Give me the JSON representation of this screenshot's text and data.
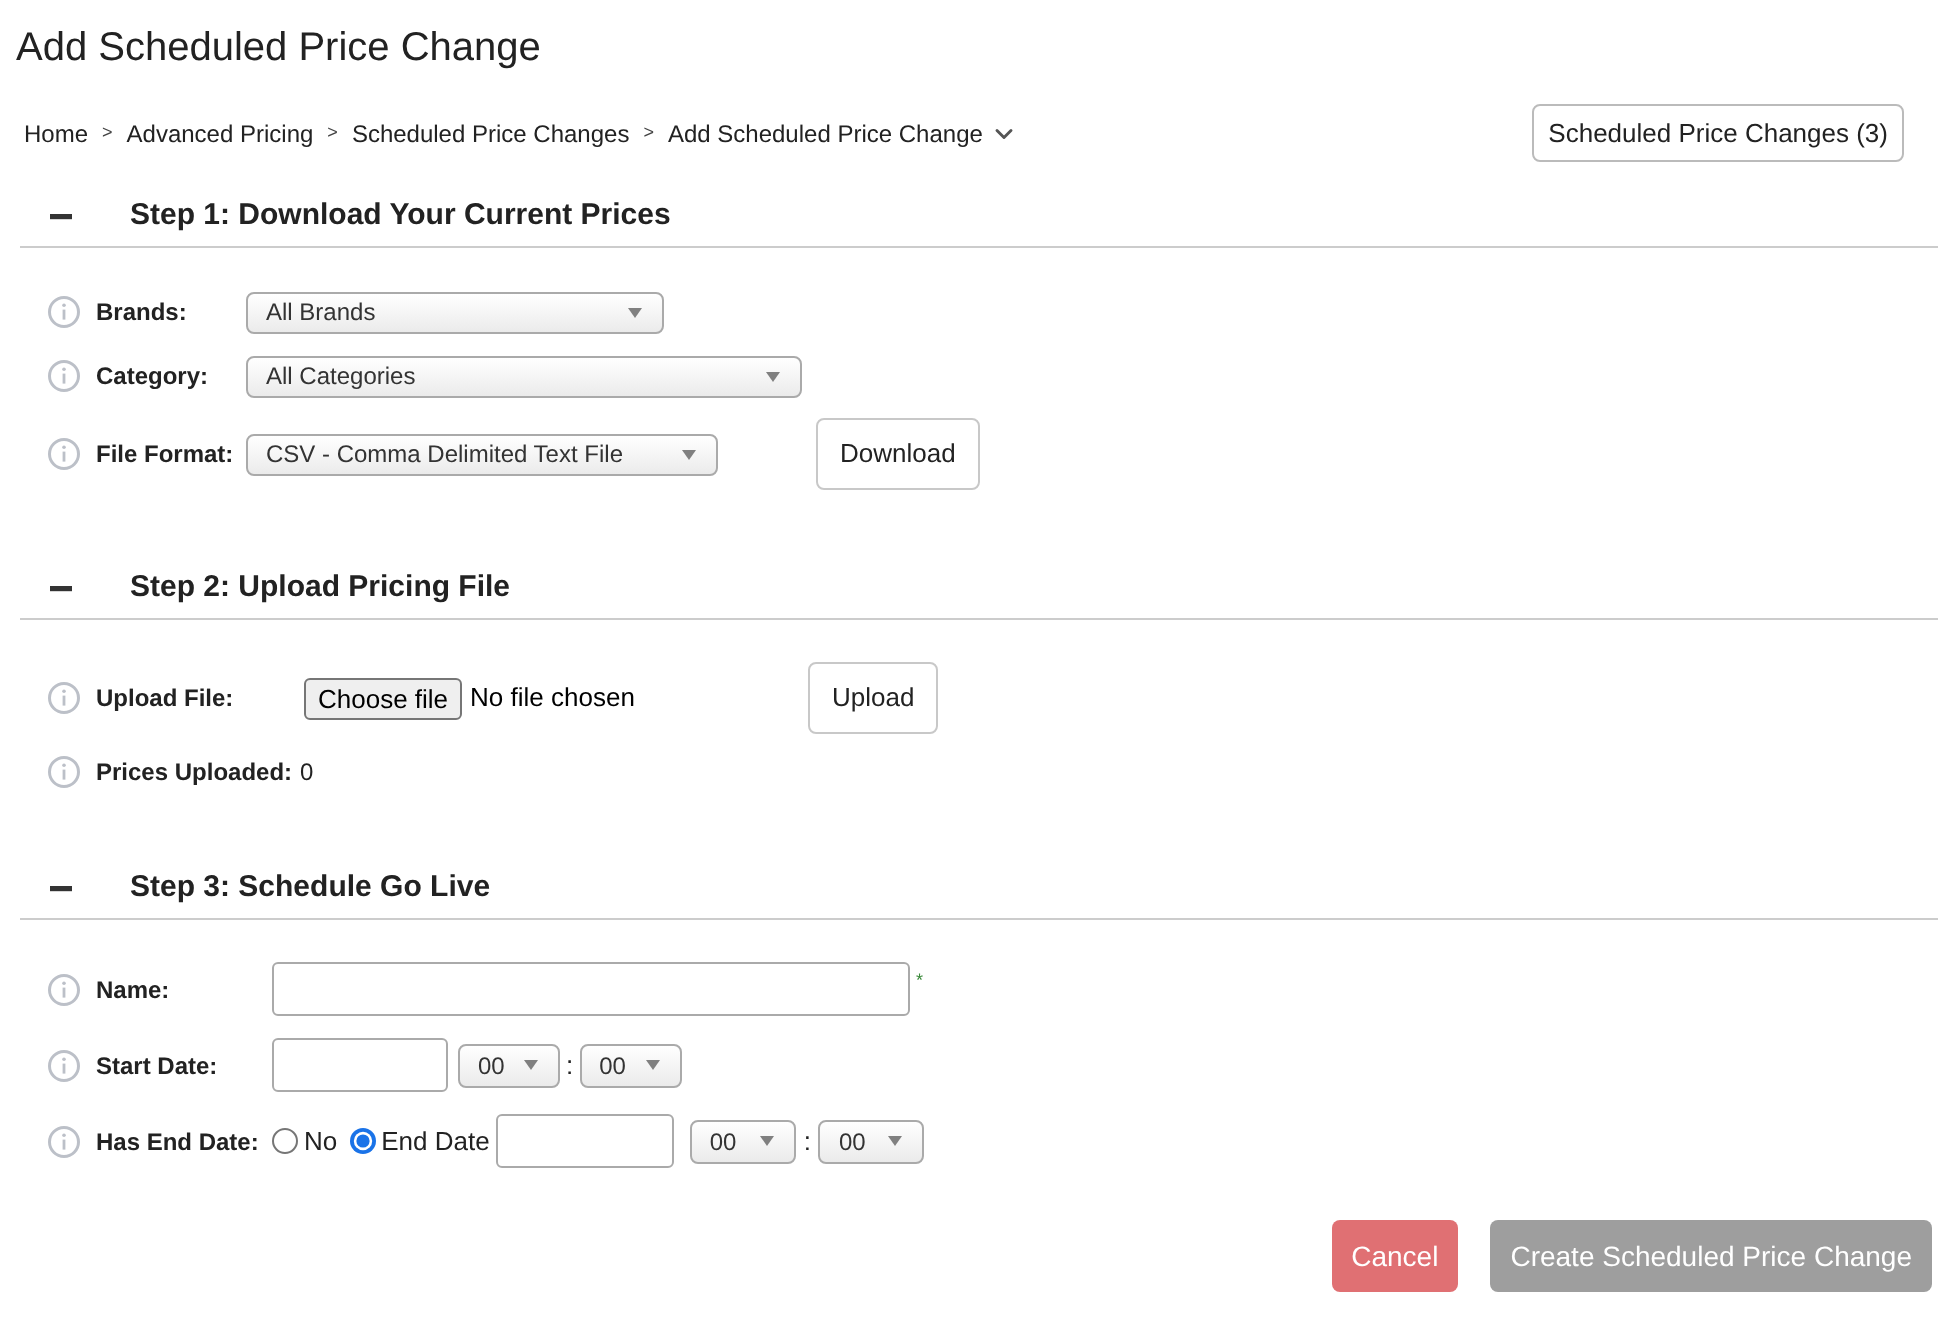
{
  "page": {
    "title": "Add Scheduled Price Change"
  },
  "breadcrumb": {
    "separator": ">",
    "items": [
      "Home",
      "Advanced Pricing",
      "Scheduled Price Changes",
      "Add Scheduled Price Change"
    ]
  },
  "header_button": {
    "label": "Scheduled Price Changes (3)"
  },
  "sections": [
    {
      "title": "Step 1: Download Your Current Prices",
      "expanded": true,
      "rows": [
        {
          "kind": "select",
          "label": "Brands:",
          "value": "All Brands"
        },
        {
          "kind": "select",
          "label": "Category:",
          "value": "All Categories"
        },
        {
          "kind": "select",
          "label": "File Format:",
          "value": "CSV - Comma Delimited Text File",
          "action": "Download"
        }
      ]
    },
    {
      "title": "Step 2: Upload Pricing File",
      "expanded": true,
      "rows": [
        {
          "kind": "file",
          "label": "Upload File:",
          "button": "Choose file",
          "status": "No file chosen",
          "action": "Upload"
        },
        {
          "kind": "value",
          "label": "Prices Uploaded:",
          "value": "0"
        }
      ]
    },
    {
      "title": "Step 3: Schedule Go Live",
      "expanded": true,
      "rows": [
        {
          "kind": "text",
          "label": "Name:",
          "required_mark": "*"
        },
        {
          "kind": "datetime",
          "label": "Start Date:",
          "hour": "00",
          "separator": ":",
          "minute": "00"
        },
        {
          "kind": "end_date",
          "label": "Has End Date:",
          "options": [
            {
              "label": "No",
              "selected": false
            },
            {
              "label": "End Date",
              "selected": true
            }
          ],
          "hour": "00",
          "separator": ":",
          "minute": "00"
        }
      ]
    }
  ],
  "footer_buttons": [
    {
      "label": "Cancel",
      "kind": "danger",
      "disabled": false
    },
    {
      "label": "Create Scheduled Price Change",
      "kind": "primary",
      "disabled": true
    }
  ]
}
